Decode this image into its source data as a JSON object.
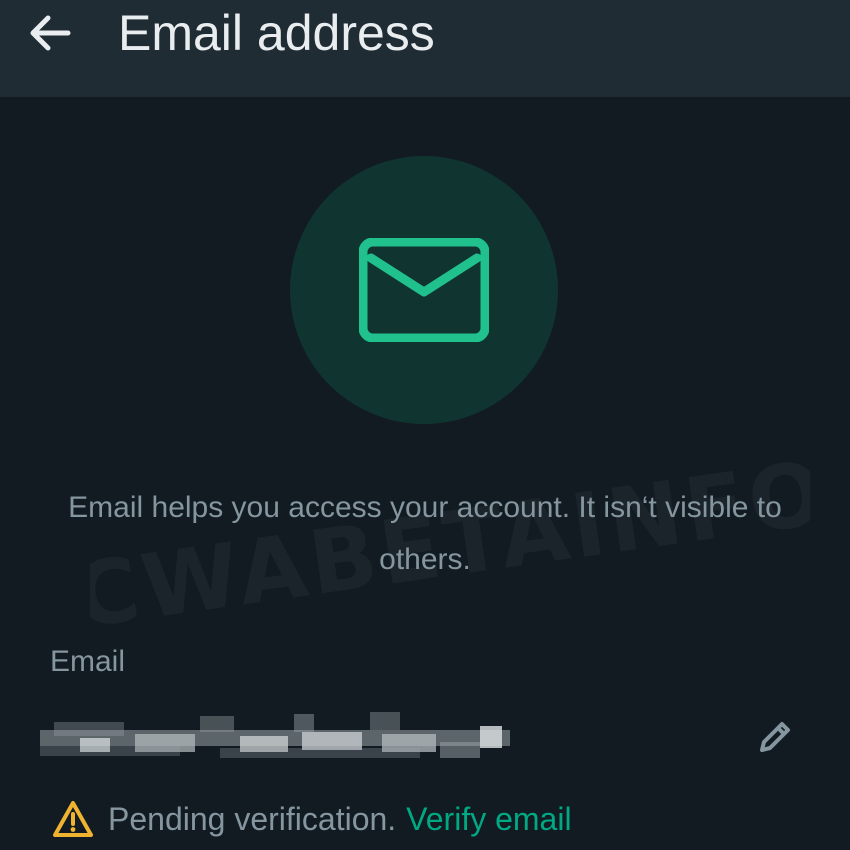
{
  "header": {
    "title": "Email address",
    "back_icon": "arrow-left-icon"
  },
  "hero": {
    "icon": "envelope-icon",
    "circle_color": "#103530",
    "icon_color": "#21c18e"
  },
  "watermark": {
    "text": "CWABETAINFO"
  },
  "description": "Email helps you access your account. It isn‘t visible to others.",
  "email_field": {
    "label": "Email",
    "value_state": "pixelated",
    "edit_icon": "pencil-icon"
  },
  "verification": {
    "warning_icon": "warning-triangle-icon",
    "status_text": "Pending verification.",
    "action_label": "Verify email"
  },
  "colors": {
    "background": "#111b21",
    "appbar": "#1f2c34",
    "primary_text": "#e9edef",
    "secondary_text": "#8696a0",
    "accent": "#00a884",
    "warning": "#f0b330"
  }
}
